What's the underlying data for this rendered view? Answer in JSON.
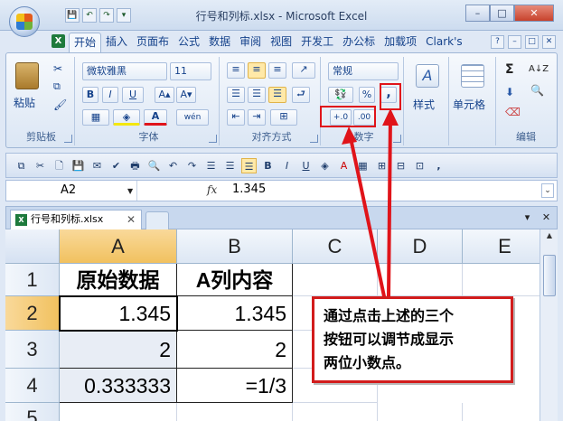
{
  "window": {
    "title": "行号和列标.xlsx - Microsoft Excel",
    "min": "–",
    "max": "□",
    "close": "✕"
  },
  "qat": [
    "💾",
    "↶",
    "↷",
    "▾"
  ],
  "tabs": [
    "开始",
    "插入",
    "页面布",
    "公式",
    "数据",
    "审阅",
    "视图",
    "开发工",
    "办公标",
    "加载项",
    "Clark's"
  ],
  "ribbon": {
    "clipboard": {
      "paste": "粘贴",
      "label": "剪贴板"
    },
    "font": {
      "name": "微软雅黑",
      "size": "11",
      "bold": "B",
      "italic": "I",
      "underline": "U",
      "grow": "A▴",
      "shrink": "A▾",
      "color": "A",
      "wen": "wén",
      "label": "字体"
    },
    "align": {
      "label": "对齐方式"
    },
    "number": {
      "format": "常规",
      "percent": "%",
      "comma": ",",
      "inc_dec": "←.0\n.00",
      "inc_label": "+.0",
      "dec_label": ".00",
      "label": "数字"
    },
    "styles": {
      "label": "样式"
    },
    "cells": {
      "label": "单元格"
    },
    "edit": {
      "sigma": "Σ",
      "sort": "A↓Z",
      "find": "🔍",
      "label": "编辑"
    }
  },
  "formula_bar": {
    "name_box": "A2",
    "fx": "fx",
    "value": "1.345"
  },
  "doc_tab": {
    "name": "行号和列标.xlsx",
    "close": "✕"
  },
  "columns": [
    "A",
    "B",
    "C",
    "D",
    "E"
  ],
  "rows": [
    "1",
    "2",
    "3",
    "4",
    "5"
  ],
  "cells": {
    "a1": "原始数据",
    "b1": "A列内容",
    "a2": "1.345",
    "b2": "1.345",
    "a3": "2",
    "b3": "2",
    "a4": "0.333333",
    "b4": "=1/3"
  },
  "callout": {
    "line1": "通过点击上述的三个",
    "line2": "按钮可以调节成显示",
    "line3": "两位小数点。"
  },
  "colors": {
    "accent_red": "#e0141a",
    "selected_header": "#f1c15f",
    "ribbon_blue": "#dfe8f5"
  }
}
